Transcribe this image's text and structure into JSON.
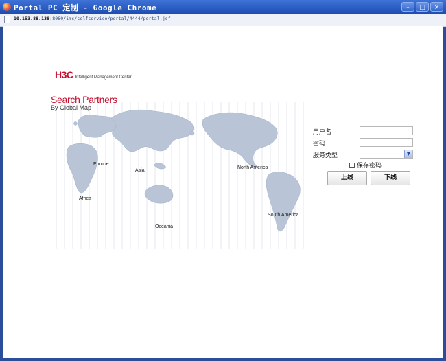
{
  "window": {
    "title": "Portal PC 定制 - Google Chrome",
    "controls": {
      "minimize": "–",
      "maximize": "□",
      "close": "×"
    }
  },
  "address_bar": {
    "host": "10.153.88.138",
    "path": ":8080/imc/selfservice/portal/4444/portal.jsf"
  },
  "logo": {
    "mark": "H3C",
    "tagline": "Intelligent Management Center"
  },
  "header": {
    "title": "Search Partners",
    "subtitle": "By Global Map"
  },
  "map": {
    "regions": [
      "Europe",
      "Asia",
      "North America",
      "Africa",
      "South America",
      "Oceania"
    ],
    "land_color": "#b8c4d6",
    "grid_color": "#e6e9ef"
  },
  "login_form": {
    "username_label": "用户名",
    "password_label": "密码",
    "service_type_label": "服务类型",
    "username_value": "",
    "password_value": "",
    "service_type_value": "",
    "remember_password_label": "保存密码",
    "remember_password_checked": false,
    "online_button": "上线",
    "offline_button": "下线"
  }
}
